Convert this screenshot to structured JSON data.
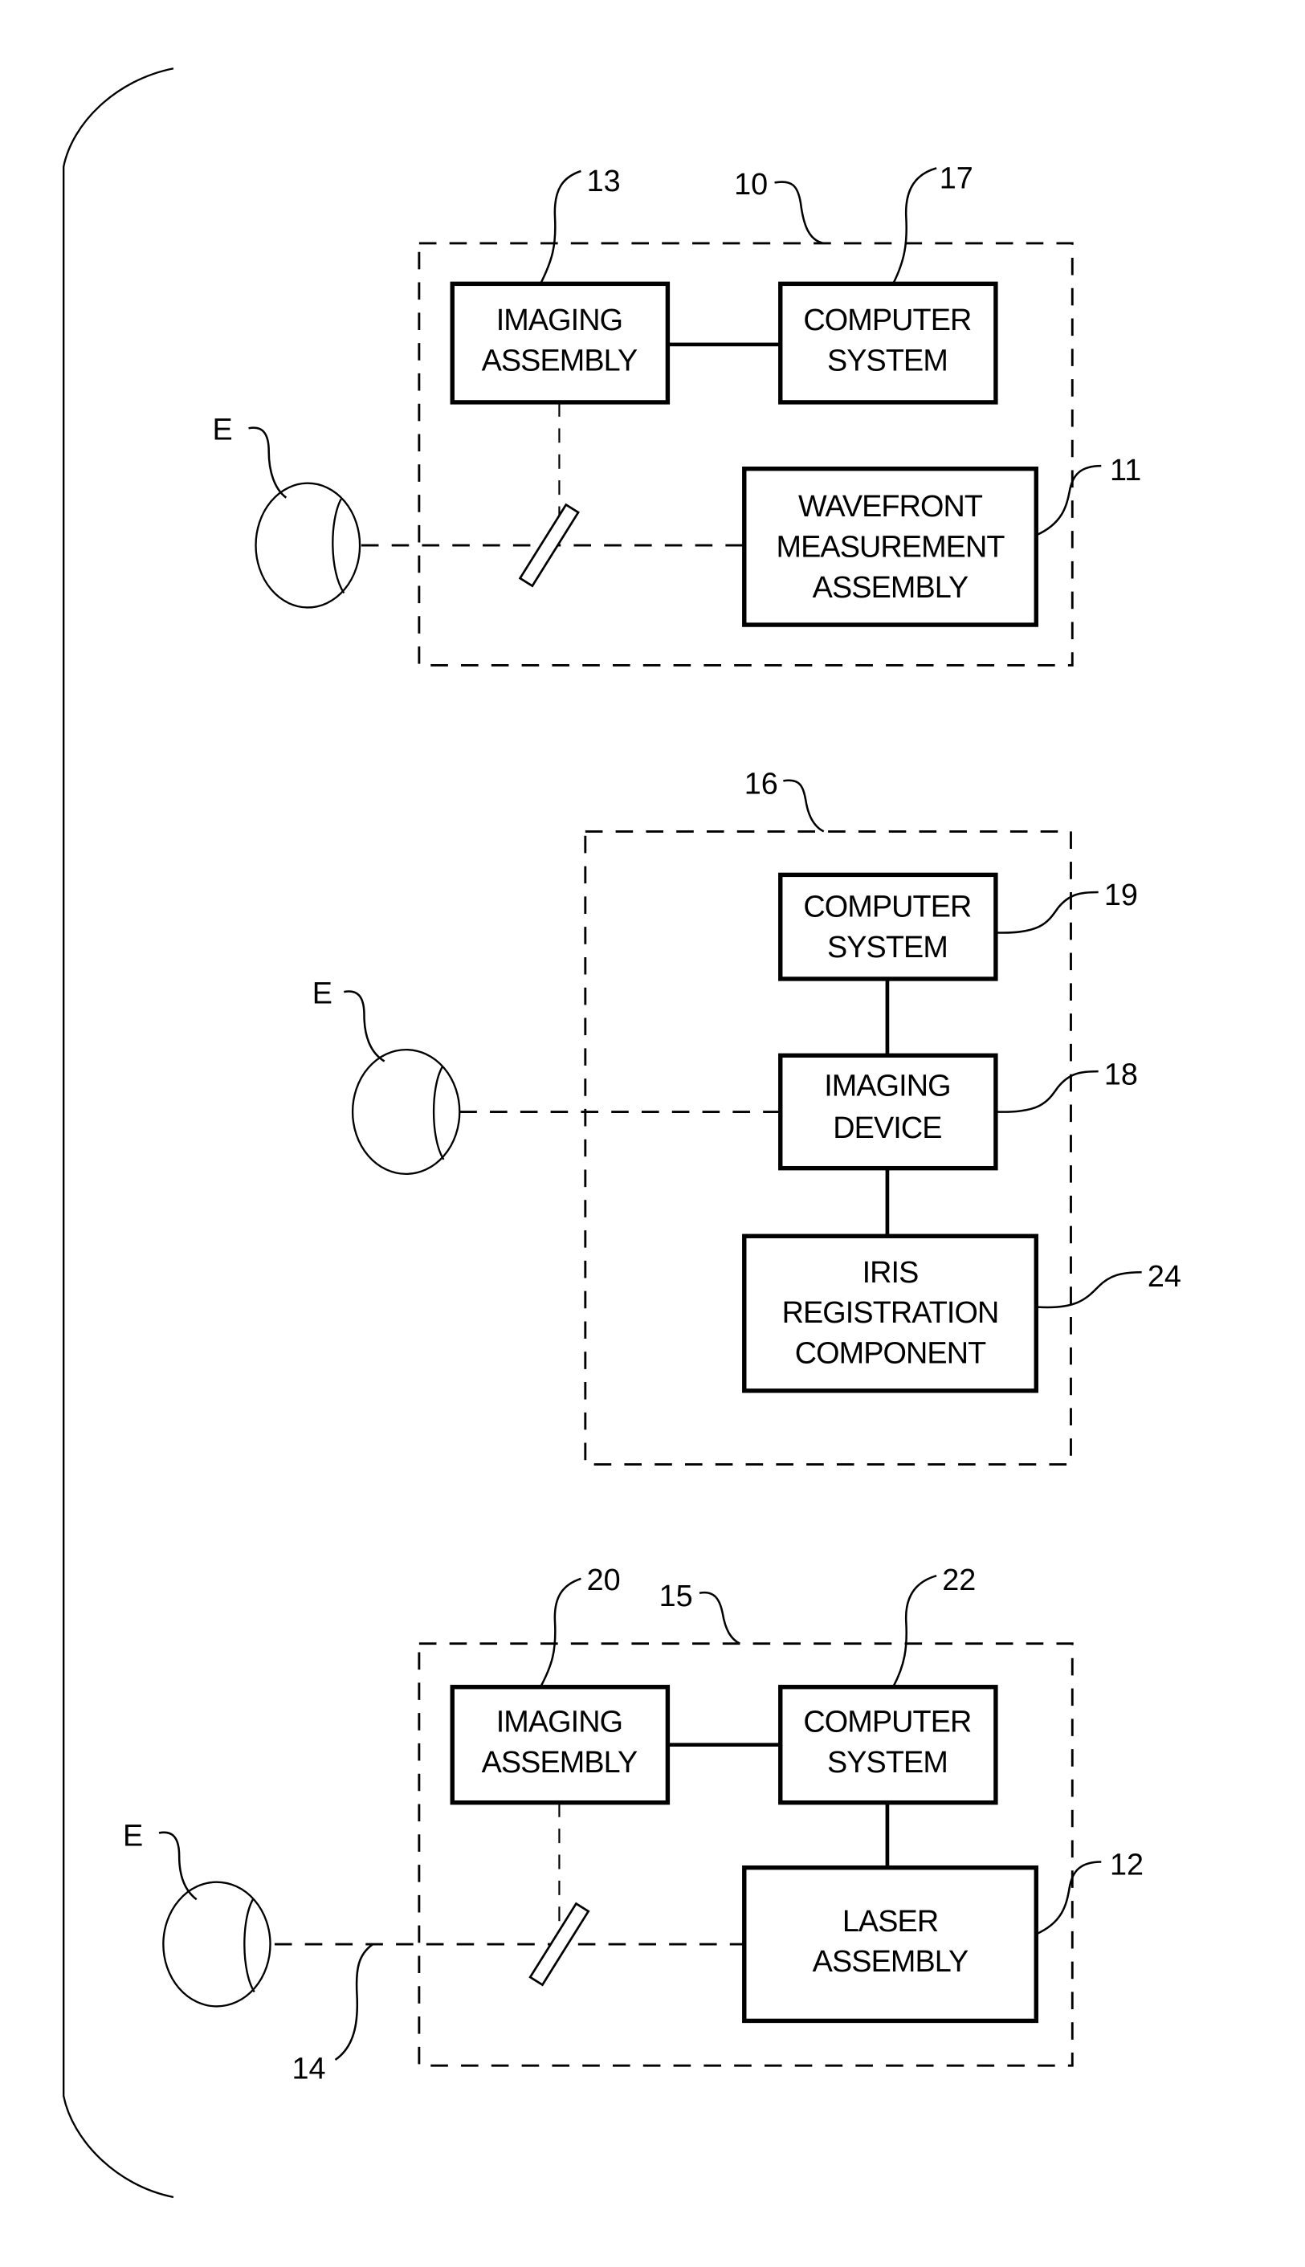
{
  "figure": {
    "eye_label": "E",
    "system_top": {
      "ref": "10",
      "imaging": {
        "ref": "13",
        "lines": [
          "IMAGING",
          "ASSEMBLY"
        ]
      },
      "computer": {
        "ref": "17",
        "lines": [
          "COMPUTER",
          "SYSTEM"
        ]
      },
      "wavefront": {
        "ref": "11",
        "lines": [
          "WAVEFRONT",
          "MEASUREMENT",
          "ASSEMBLY"
        ]
      }
    },
    "system_middle": {
      "ref": "16",
      "computer": {
        "ref": "19",
        "lines": [
          "COMPUTER",
          "SYSTEM"
        ]
      },
      "imaging": {
        "ref": "18",
        "lines": [
          "IMAGING",
          "DEVICE"
        ]
      },
      "iris": {
        "ref": "24",
        "lines": [
          "IRIS",
          "REGISTRATION",
          "COMPONENT"
        ]
      }
    },
    "system_bottom": {
      "ref": "15",
      "imaging": {
        "ref": "20",
        "lines": [
          "IMAGING",
          "ASSEMBLY"
        ]
      },
      "computer": {
        "ref": "22",
        "lines": [
          "COMPUTER",
          "SYSTEM"
        ]
      },
      "laser": {
        "ref": "12",
        "lines": [
          "LASER",
          "ASSEMBLY"
        ]
      },
      "beam_ref": "14"
    }
  }
}
